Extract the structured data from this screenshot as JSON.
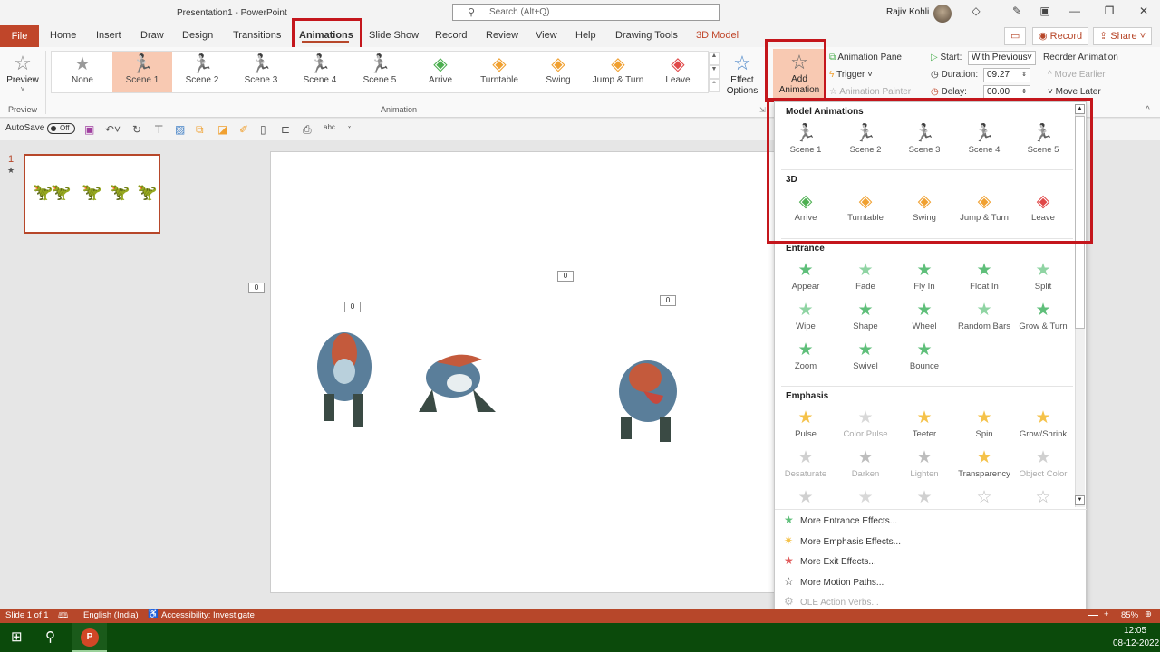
{
  "window": {
    "title": "Presentation1  -  PowerPoint",
    "search_placeholder": "Search (Alt+Q)",
    "user_name": "Rajiv Kohli",
    "controls": {
      "minimize": "—",
      "restore": "❐",
      "close": "✕"
    }
  },
  "tabs": [
    {
      "label": "File"
    },
    {
      "label": "Home"
    },
    {
      "label": "Insert"
    },
    {
      "label": "Draw"
    },
    {
      "label": "Design"
    },
    {
      "label": "Transitions"
    },
    {
      "label": "Animations"
    },
    {
      "label": "Slide Show"
    },
    {
      "label": "Record"
    },
    {
      "label": "Review"
    },
    {
      "label": "View"
    },
    {
      "label": "Help"
    },
    {
      "label": "Drawing Tools"
    },
    {
      "label": "3D Model"
    }
  ],
  "tab_right": {
    "comments_icon": "comment-icon",
    "record_label": "Record",
    "share_label": "Share"
  },
  "ribbon": {
    "preview": {
      "label": "Preview",
      "group_label": "Preview"
    },
    "animation_group_label": "Animation",
    "gallery": [
      {
        "label": "None",
        "icon": "star-icon",
        "glyph": "★",
        "color": "#999999"
      },
      {
        "label": "Scene 1",
        "icon": "running-figure-icon",
        "glyph": "🏃",
        "selected": true
      },
      {
        "label": "Scene 2",
        "icon": "running-figure-icon",
        "glyph": "🏃"
      },
      {
        "label": "Scene 3",
        "icon": "running-figure-icon",
        "glyph": "🏃"
      },
      {
        "label": "Scene 4",
        "icon": "running-figure-icon",
        "glyph": "🏃"
      },
      {
        "label": "Scene 5",
        "icon": "running-figure-icon",
        "glyph": "🏃"
      },
      {
        "label": "Arrive",
        "icon": "cube-green-icon",
        "glyph": "◈",
        "color": "#4caf50"
      },
      {
        "label": "Turntable",
        "icon": "cube-orange-icon",
        "glyph": "◈",
        "color": "#f0a030"
      },
      {
        "label": "Swing",
        "icon": "cube-orange-icon",
        "glyph": "◈",
        "color": "#f0a030"
      },
      {
        "label": "Jump & Turn",
        "icon": "cube-orange-icon",
        "glyph": "◈",
        "color": "#f0a030"
      },
      {
        "label": "Leave",
        "icon": "cube-red-icon",
        "glyph": "◈",
        "color": "#e04848"
      }
    ],
    "effect_options_label": "Effect Options",
    "add_animation_label": "Add Animation",
    "animation_pane_label": "Animation Pane",
    "trigger_label": "Trigger",
    "animation_painter_label": "Animation Painter",
    "start_label": "Start:",
    "start_value": "With Previous",
    "duration_label": "Duration:",
    "duration_value": "09.27",
    "delay_label": "Delay:",
    "delay_value": "00.00",
    "reorder_label": "Reorder Animation",
    "move_earlier_label": "Move Earlier",
    "move_later_label": "Move Later"
  },
  "qat": {
    "autosave_label": "AutoSave",
    "autosave_state": "Off"
  },
  "thumbnails": [
    {
      "number": "1",
      "star": "★"
    }
  ],
  "slide": {
    "tags": [
      "0",
      "0",
      "0",
      "0"
    ]
  },
  "dropdown": {
    "sections": [
      {
        "title": "Model Animations",
        "items": [
          {
            "label": "Scene 1",
            "icon": "running-figure-icon",
            "glyph": "🏃"
          },
          {
            "label": "Scene 2",
            "icon": "running-figure-icon",
            "glyph": "🏃"
          },
          {
            "label": "Scene 3",
            "icon": "running-figure-icon",
            "glyph": "🏃"
          },
          {
            "label": "Scene 4",
            "icon": "running-figure-icon",
            "glyph": "🏃"
          },
          {
            "label": "Scene 5",
            "icon": "running-figure-icon",
            "glyph": "🏃"
          }
        ]
      },
      {
        "title": "3D",
        "items": [
          {
            "label": "Arrive",
            "icon": "cube-green-icon",
            "glyph": "◈",
            "color": "#4caf50"
          },
          {
            "label": "Turntable",
            "icon": "cube-orange-icon",
            "glyph": "◈",
            "color": "#f0a030"
          },
          {
            "label": "Swing",
            "icon": "cube-orange-icon",
            "glyph": "◈",
            "color": "#f0a030"
          },
          {
            "label": "Jump & Turn",
            "icon": "cube-orange-icon",
            "glyph": "◈",
            "color": "#f0a030"
          },
          {
            "label": "Leave",
            "icon": "cube-red-icon",
            "glyph": "◈",
            "color": "#e04848"
          }
        ]
      },
      {
        "title": "Entrance",
        "items": [
          {
            "label": "Appear",
            "glyph": "★",
            "color": "#5fbf7a"
          },
          {
            "label": "Fade",
            "glyph": "★",
            "color": "#8fd4a3"
          },
          {
            "label": "Fly In",
            "glyph": "★",
            "color": "#5fbf7a"
          },
          {
            "label": "Float In",
            "glyph": "★",
            "color": "#5fbf7a"
          },
          {
            "label": "Split",
            "glyph": "★",
            "color": "#8fd4a3"
          },
          {
            "label": "Wipe",
            "glyph": "★",
            "color": "#8fd4a3"
          },
          {
            "label": "Shape",
            "glyph": "★",
            "color": "#5fbf7a"
          },
          {
            "label": "Wheel",
            "glyph": "★",
            "color": "#5fbf7a"
          },
          {
            "label": "Random Bars",
            "glyph": "★",
            "color": "#8fd4a3"
          },
          {
            "label": "Grow & Turn",
            "glyph": "★",
            "color": "#5fbf7a"
          },
          {
            "label": "Zoom",
            "glyph": "★",
            "color": "#5fbf7a"
          },
          {
            "label": "Swivel",
            "glyph": "★",
            "color": "#5fbf7a"
          },
          {
            "label": "Bounce",
            "glyph": "★",
            "color": "#5fbf7a"
          }
        ]
      },
      {
        "title": "Emphasis",
        "items": [
          {
            "label": "Pulse",
            "glyph": "★",
            "color": "#f5c24a"
          },
          {
            "label": "Color Pulse",
            "glyph": "★",
            "color": "#d8d8d8",
            "disabled": true
          },
          {
            "label": "Teeter",
            "glyph": "★",
            "color": "#f5c24a"
          },
          {
            "label": "Spin",
            "glyph": "★",
            "color": "#f5c24a"
          },
          {
            "label": "Grow/Shrink",
            "glyph": "★",
            "color": "#f5c24a"
          },
          {
            "label": "Desaturate",
            "glyph": "★",
            "color": "#d0d0d0",
            "disabled": true
          },
          {
            "label": "Darken",
            "glyph": "★",
            "color": "#bdbdbd",
            "disabled": true
          },
          {
            "label": "Lighten",
            "glyph": "★",
            "color": "#bdbdbd",
            "disabled": true
          },
          {
            "label": "Transparency",
            "glyph": "★",
            "color": "#f5c24a"
          },
          {
            "label": "Object Color",
            "glyph": "★",
            "color": "#d0d0d0",
            "disabled": true
          },
          {
            "label": "",
            "glyph": "★",
            "color": "#d0d0d0",
            "disabled": true
          },
          {
            "label": "",
            "glyph": "★",
            "color": "#d8d8d8",
            "disabled": true
          },
          {
            "label": "",
            "glyph": "★",
            "color": "#d0d0d0",
            "disabled": true
          },
          {
            "label": "",
            "glyph": "☆",
            "color": "#bdbdbd",
            "disabled": true
          },
          {
            "label": "",
            "glyph": "☆",
            "color": "#bdbdbd",
            "disabled": true
          }
        ]
      }
    ],
    "more": [
      {
        "label": "More Entrance Effects...",
        "glyph": "★",
        "color": "#5fbf7a"
      },
      {
        "label": "More Emphasis Effects...",
        "glyph": "✷",
        "color": "#f5c24a"
      },
      {
        "label": "More Exit Effects...",
        "glyph": "★",
        "color": "#e05a5a"
      },
      {
        "label": "More Motion Paths...",
        "glyph": "☆",
        "color": "#333333"
      },
      {
        "label": "OLE Action Verbs...",
        "glyph": "⚙",
        "color": "#bbbbbb",
        "disabled": true
      }
    ]
  },
  "status": {
    "slide_info": "Slide 1 of 1",
    "language": "English (India)",
    "accessibility": "Accessibility: Investigate",
    "zoom_level": "85%"
  },
  "taskbar": {
    "time": "12:05",
    "date": "08-12-2022"
  },
  "colors": {
    "accent": "#b7472a",
    "highlight_box": "#c4161c",
    "selected_fill": "#f8c9b2",
    "taskbar": "#0b4a0b"
  }
}
